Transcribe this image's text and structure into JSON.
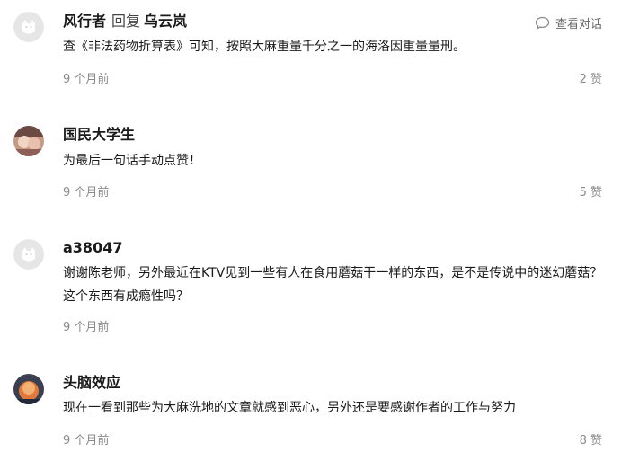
{
  "comments": [
    {
      "author": "风行者",
      "reply_word": "回复",
      "reply_to": "乌云岚",
      "view_conversation": "查看对话",
      "view_icon": "speech-bubble-icon",
      "avatar": "default-avatar",
      "text": "查《非法药物折算表》可知，按照大麻重量千分之一的海洛因重量量刑。",
      "time": "9 个月前",
      "likes": "2 赞"
    },
    {
      "author": "国民大学生",
      "avatar": "photo-avatar",
      "text": "为最后一句话手动点赞！",
      "time": "9 个月前",
      "likes": "5 赞"
    },
    {
      "author": "a38047",
      "avatar": "default-avatar",
      "text": "谢谢陈老师，另外最近在KTV见到一些有人在食用蘑菇干一样的东西，是不是传说中的迷幻蘑菇？这个东西有成瘾性吗？",
      "time": "9 个月前",
      "likes": ""
    },
    {
      "author": "头脑效应",
      "avatar": "photo-avatar",
      "text": "现在一看到那些为大麻洗地的文章就感到恶心，另外还是要感谢作者的工作与努力",
      "time": "9 个月前",
      "likes": "8 赞"
    }
  ]
}
